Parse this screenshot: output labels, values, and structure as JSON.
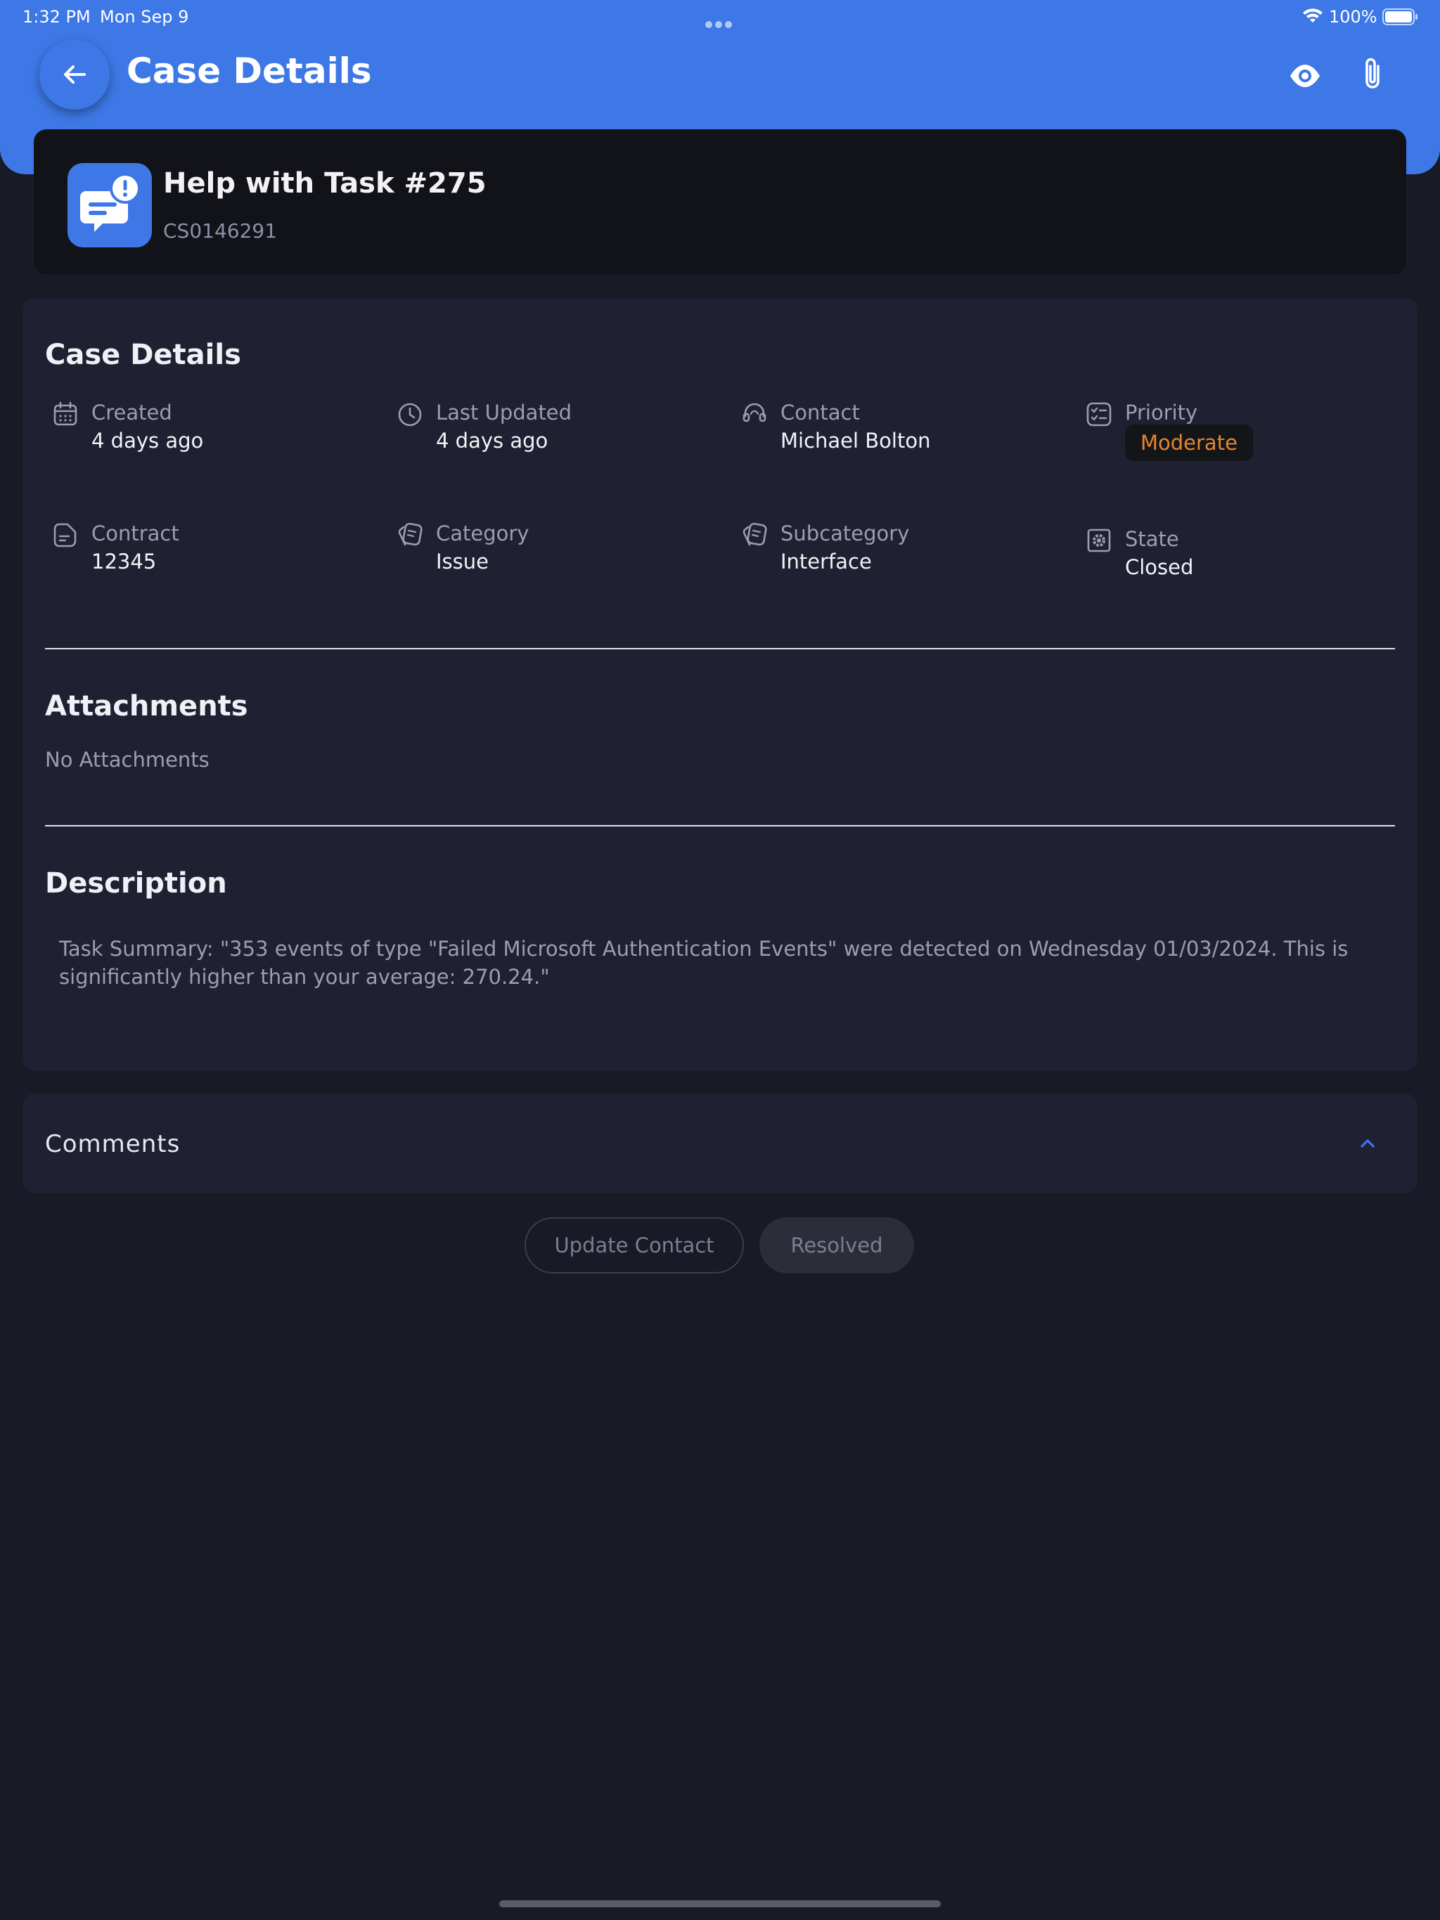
{
  "status_bar": {
    "time": "1:32 PM",
    "date": "Mon Sep 9",
    "battery": "100%"
  },
  "header": {
    "title": "Case Details"
  },
  "case": {
    "title": "Help with Task #275",
    "number": "CS0146291"
  },
  "details": {
    "section_title": "Case Details",
    "created": {
      "label": "Created",
      "value": "4 days ago"
    },
    "last_updated": {
      "label": "Last Updated",
      "value": "4 days ago"
    },
    "contact": {
      "label": "Contact",
      "value": "Michael Bolton"
    },
    "priority": {
      "label": "Priority",
      "value": "Moderate"
    },
    "contract": {
      "label": "Contract",
      "value": "12345"
    },
    "category": {
      "label": "Category",
      "value": "Issue"
    },
    "subcategory": {
      "label": "Subcategory",
      "value": "Interface"
    },
    "state": {
      "label": "State",
      "value": "Closed"
    }
  },
  "attachments": {
    "section_title": "Attachments",
    "empty_text": "No Attachments"
  },
  "description": {
    "section_title": "Description",
    "text": "Task Summary: \"353 events of type \"Failed Microsoft Authentication Events\" were detected on Wednesday 01/03/2024. This is significantly higher than your average: 270.24.\""
  },
  "comments": {
    "label": "Comments"
  },
  "actions": {
    "update_contact": "Update Contact",
    "resolved": "Resolved"
  },
  "colors": {
    "accent": "#3d78e6",
    "background": "#181a26",
    "card": "#1f2132",
    "priority_moderate": "#e3862c"
  }
}
